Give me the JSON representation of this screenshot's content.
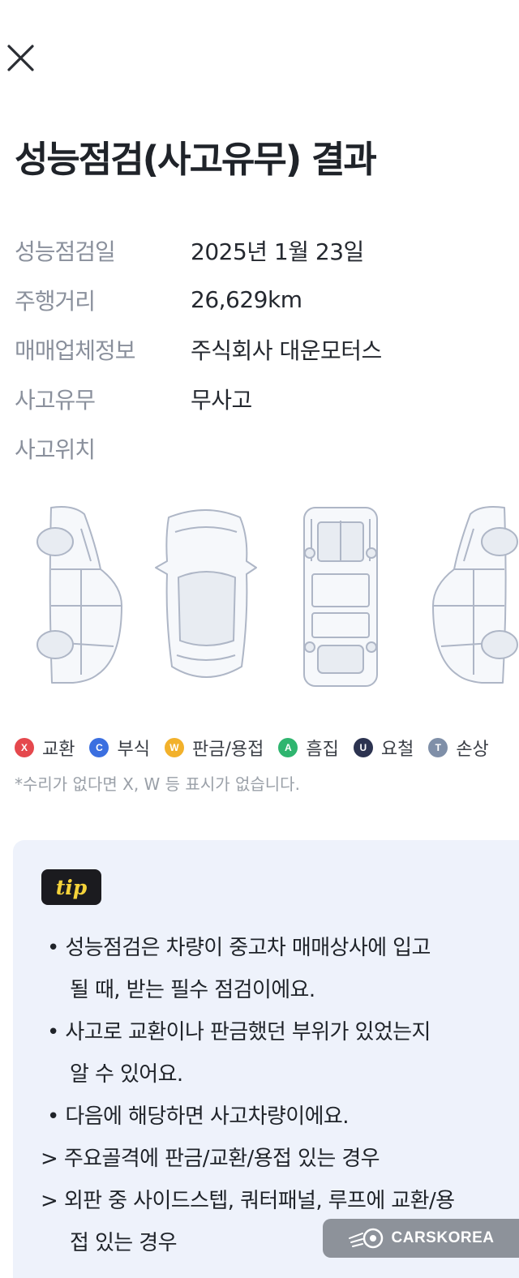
{
  "header": {
    "close_icon": "close-icon"
  },
  "page_title": "성능점검(사고유무) 결과",
  "info": [
    {
      "label": "성능점검일",
      "value": "2025년 1월 23일"
    },
    {
      "label": "주행거리",
      "value": "26,629km"
    },
    {
      "label": "매매업체정보",
      "value": "주식회사 대운모터스"
    },
    {
      "label": "사고유무",
      "value": "무사고"
    },
    {
      "label": "사고위치",
      "value": ""
    }
  ],
  "diagram": {
    "views": [
      "left-side-view",
      "top-view",
      "underbody-view",
      "right-side-view"
    ],
    "line_color": "#aeb6c6",
    "fill_color": "#e8ecf2"
  },
  "legend": [
    {
      "letter": "X",
      "label": "교환",
      "color": "#e5484d"
    },
    {
      "letter": "C",
      "label": "부식",
      "color": "#3b6fe0"
    },
    {
      "letter": "W",
      "label": "판금/용접",
      "color": "#f2b12b"
    },
    {
      "letter": "A",
      "label": "흠집",
      "color": "#2fb56f"
    },
    {
      "letter": "U",
      "label": "요철",
      "color": "#2c3350"
    },
    {
      "letter": "T",
      "label": "손상",
      "color": "#7f8fa8"
    }
  ],
  "legend_note": "*수리가 없다면 X, W 등 표시가 없습니다.",
  "tip": {
    "badge": "tip",
    "lines": [
      "• 성능점검은 차량이 중고차 매매상사에 입고",
      "될 때, 받는 필수 점검이에요.",
      "• 사고로 교환이나 판금했던 부위가 있었는지",
      "알 수 있어요.",
      "• 다음에 해당하면 사고차량이에요.",
      "> 주요골격에 판금/교환/용접 있는 경우",
      "> 외판 중 사이드스텝, 쿼터패널, 루프에 교환/용",
      "접 있는 경우"
    ]
  },
  "watermark": {
    "text": "CARSKOREA",
    "icon": "carskorea-logo-icon"
  },
  "colors": {
    "label_gray": "#8a909c",
    "tip_bg": "#eef2fb",
    "badge_bg": "#1b1b1f",
    "badge_text": "#f5d33a"
  }
}
